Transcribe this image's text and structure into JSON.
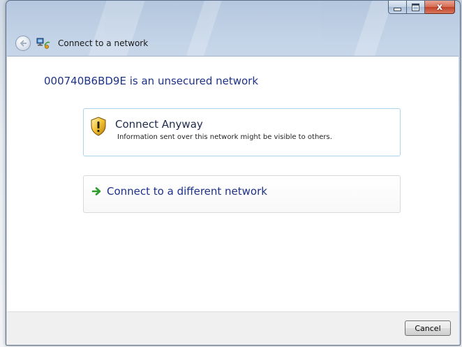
{
  "window": {
    "title": "Connect to a network",
    "caption_buttons": {
      "minimize_icon": "minimize-icon",
      "maximize_icon": "maximize-icon",
      "close_glyph": "x"
    }
  },
  "nav": {
    "back_icon": "back-arrow-icon",
    "app_icon": "network-connect-icon"
  },
  "main": {
    "heading": "000740B6BD9E is an unsecured network",
    "options": [
      {
        "title": "Connect Anyway",
        "description": "Information sent over this network might be visible to others.",
        "icon": "warning-shield-icon"
      },
      {
        "title": "Connect to a different network",
        "icon": "green-arrow-icon"
      }
    ]
  },
  "footer": {
    "cancel_label": "Cancel"
  },
  "colors": {
    "heading": "#1e3287",
    "option_border_selected": "#a8d4ee",
    "option_border": "#d9d9d9",
    "footer_bg": "#f0f0f0",
    "close_button": "#c0432a",
    "arrow_green": "#2e9b2e",
    "shield_yellow": "#f2c232"
  }
}
